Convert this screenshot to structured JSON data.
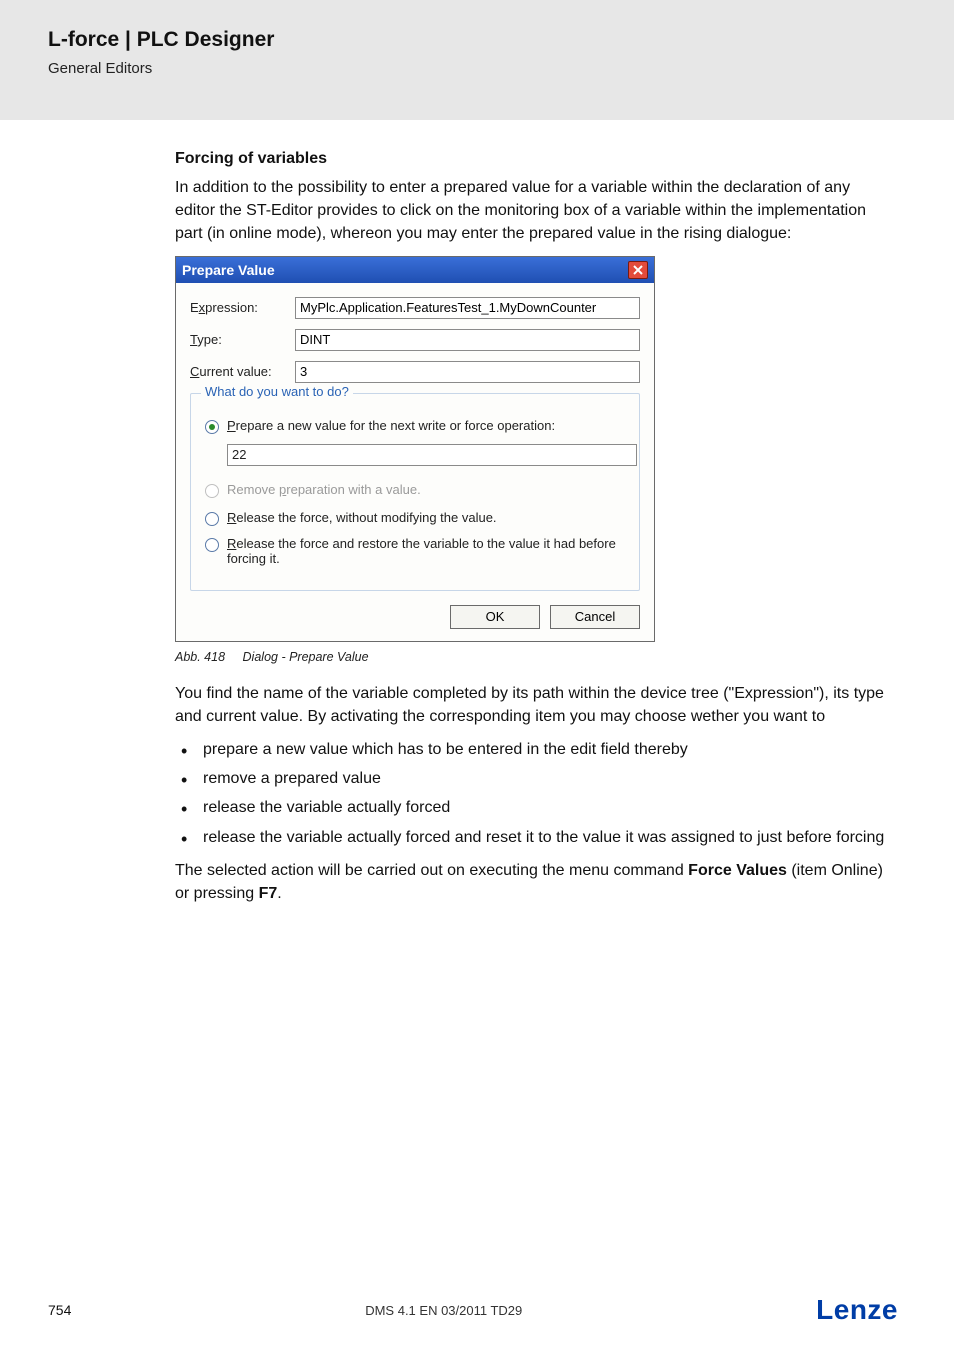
{
  "header": {
    "product": "L-force | PLC Designer",
    "section": "General Editors"
  },
  "body": {
    "h1": "Forcing of variables",
    "intro": "In addition to the possibility to enter a prepared value for a variable within the declaration of any editor the ST-Editor provides to click on the monitoring box of a variable within the implementation part (in online mode), whereon you may enter the prepared value in the rising dialogue:",
    "caption_num": "Abb. 418",
    "caption_text": "Dialog - Prepare Value",
    "para2": "You find the name of the variable completed by its path within the device tree (\"Expression\"), its type and current value. By activating the corresponding item you may choose wether you want to",
    "bullets": [
      "prepare a new value which has to be entered in the edit field thereby",
      "remove a prepared value",
      "release the variable actually forced",
      "release the variable actually forced and reset it to the value it was assigned to just before forcing"
    ],
    "para3_pre": "The selected action will be carried out on executing the menu command ",
    "para3_cmd": "Force Values",
    "para3_mid": " (item Online) or pressing ",
    "para3_key": "F7",
    "para3_end": "."
  },
  "dialog": {
    "title": "Prepare Value",
    "expression_label": "Expression:",
    "expression_value": "MyPlc.Application.FeaturesTest_1.MyDownCounter",
    "type_label": "Type:",
    "type_value": "DINT",
    "current_label": "Current value:",
    "current_value": "3",
    "group_legend": "What do you want to do?",
    "opt_prepare": "Prepare a new value for the next write or force operation:",
    "prepare_value": "22",
    "opt_remove": "Remove preparation with a value.",
    "opt_release": "Release the force, without modifying the value.",
    "opt_restore": "Release the force and restore the variable to the value it had before forcing it.",
    "ok": "OK",
    "cancel": "Cancel"
  },
  "footer": {
    "page": "754",
    "docid": "DMS 4.1 EN 03/2011 TD29",
    "logo": "Lenze"
  }
}
